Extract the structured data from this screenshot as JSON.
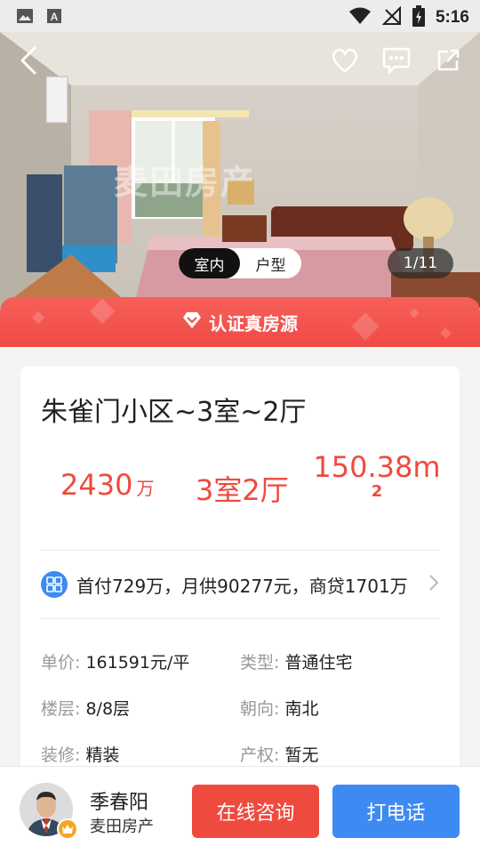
{
  "status_bar": {
    "time": "5:16",
    "icons": [
      "image-icon",
      "text-a-icon",
      "wifi-icon",
      "no-signal-icon",
      "battery-charging-icon"
    ]
  },
  "hero": {
    "watermark": "麦田房产",
    "tabs": [
      {
        "label": "室内",
        "active": true
      },
      {
        "label": "户型",
        "active": false
      }
    ],
    "counter": "1/11",
    "top_icons": [
      "back-arrow-icon",
      "heart-icon",
      "chat-icon",
      "share-icon"
    ]
  },
  "banner": {
    "label": "认证真房源",
    "color": "#f04a45"
  },
  "listing": {
    "title": "朱雀门小区~3室~2厅",
    "price_value": "2430",
    "price_unit": "万",
    "layout": "3室2厅",
    "area_value": "150.38m",
    "area_sup": "2",
    "loan_text": "首付729万，月供90277元，商贷1701万",
    "details": [
      {
        "key": "单价:",
        "value": "161591元/平"
      },
      {
        "key": "类型:",
        "value": "普通住宅"
      },
      {
        "key": "楼层:",
        "value": "8/8层"
      },
      {
        "key": "朝向:",
        "value": "南北"
      },
      {
        "key": "装修:",
        "value": "精装"
      },
      {
        "key": "产权:",
        "value": "暂无"
      }
    ]
  },
  "agent": {
    "name": "季春阳",
    "company": "麦田房产",
    "consult_label": "在线咨询",
    "call_label": "打电话"
  },
  "colors": {
    "accent_red": "#ef4a3e",
    "accent_blue": "#3d8bf2"
  }
}
